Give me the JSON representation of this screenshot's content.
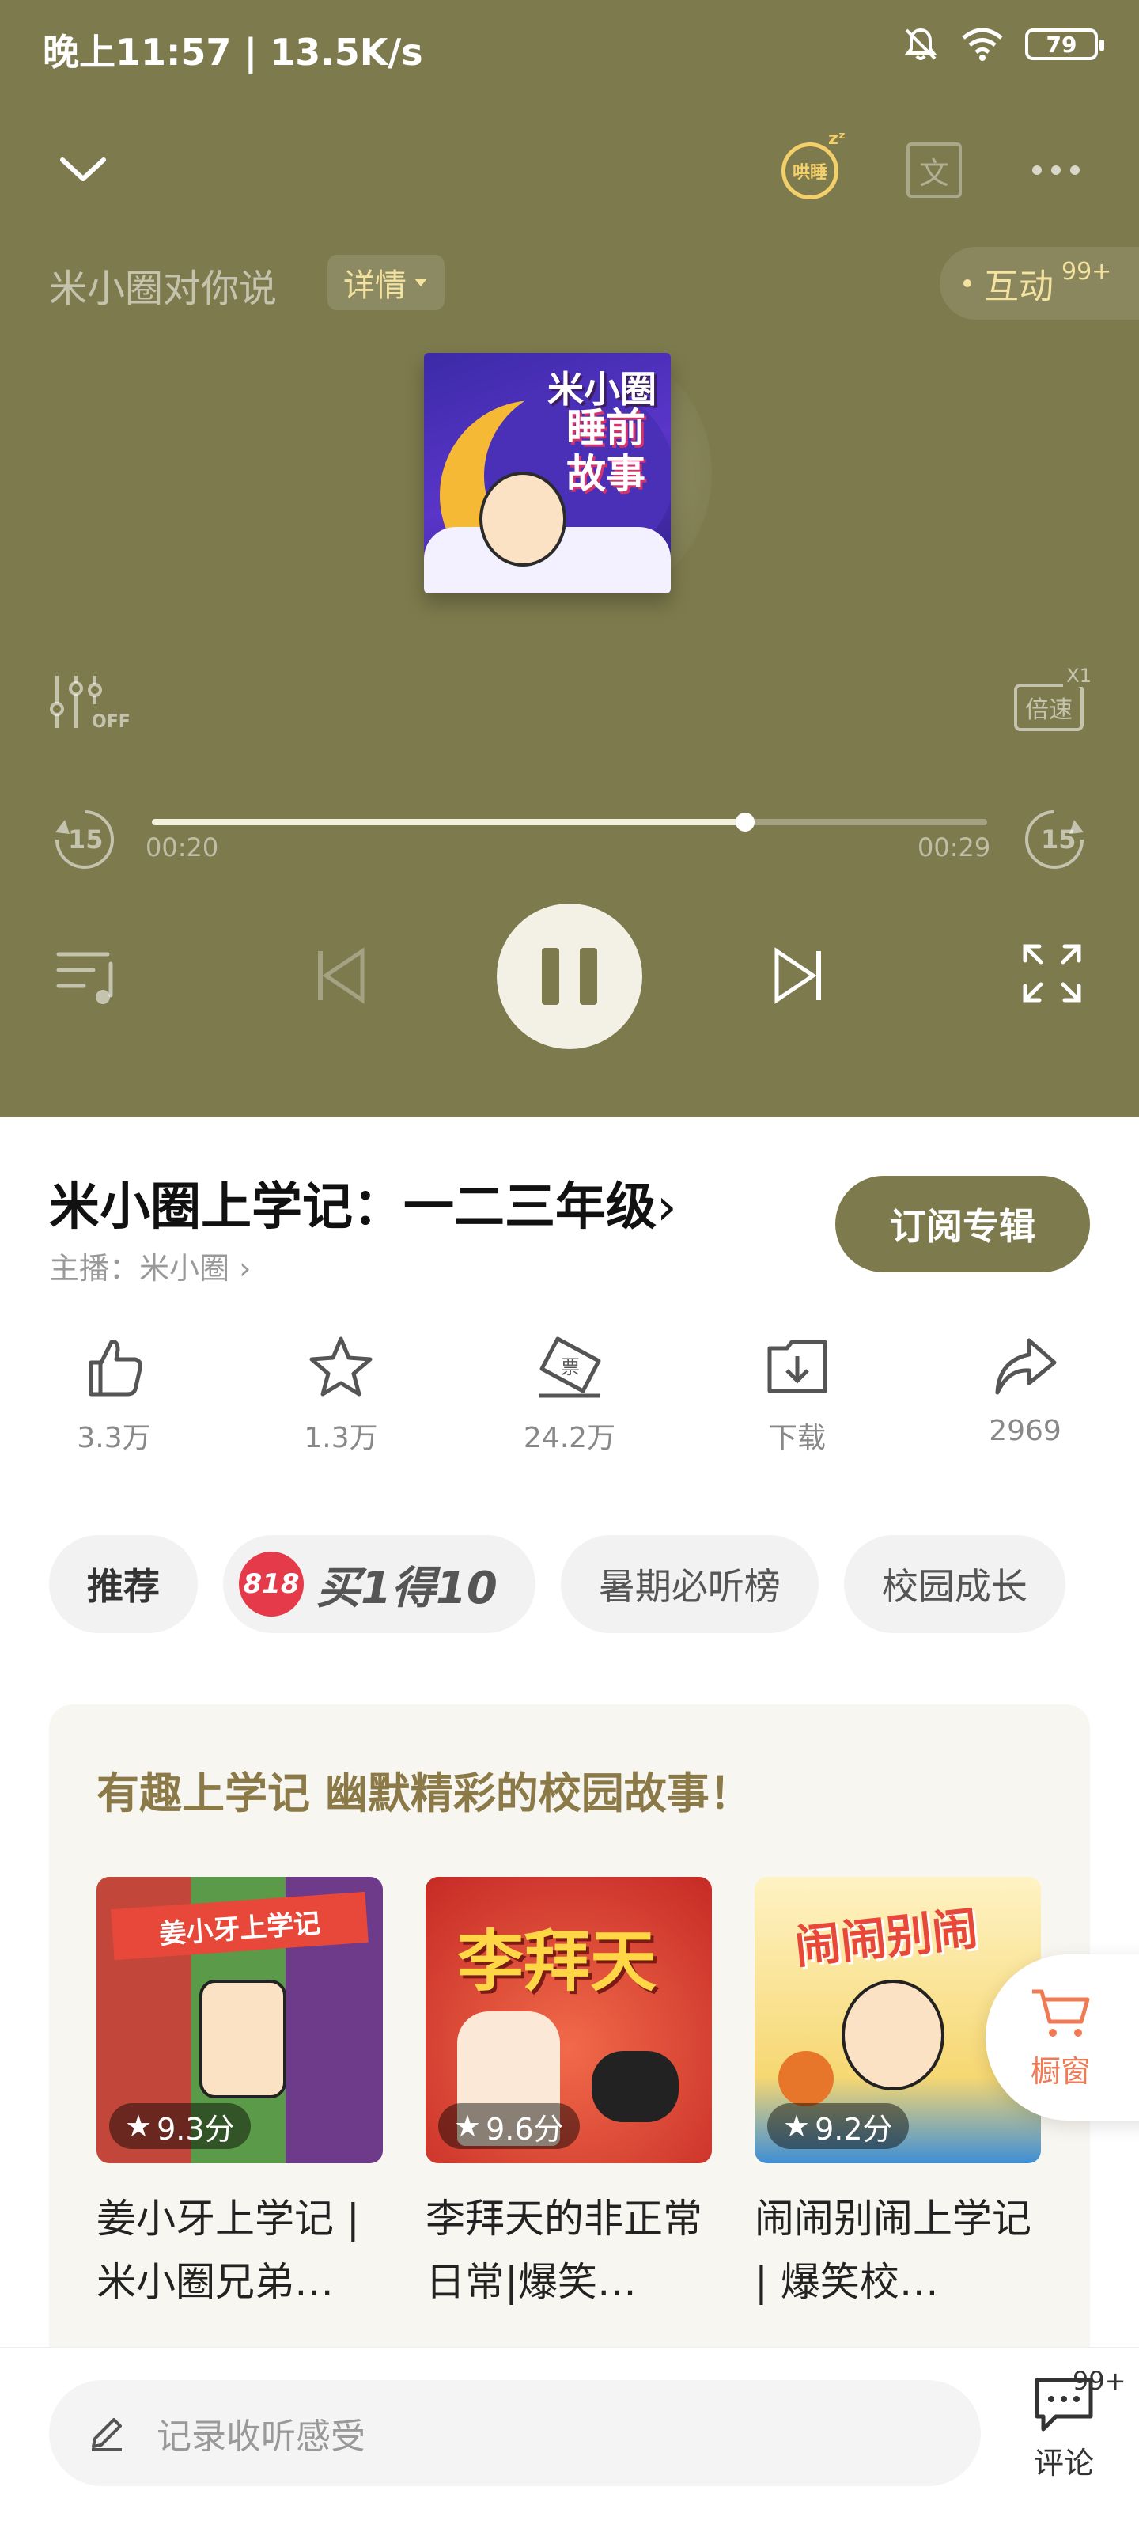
{
  "status_bar": {
    "time_speed": "晚上11:57 | 13.5K/s",
    "battery": "79"
  },
  "top_bar": {
    "sleep_label": "哄睡",
    "text_label": "文"
  },
  "player": {
    "album_by": "米小圈对你说",
    "detail_label": "详情",
    "interact_label": "互动",
    "interact_badge": "99+",
    "eq_label": "OFF",
    "speed_label": "倍速",
    "speed_value": "X1",
    "skip_back_label": "15",
    "skip_fwd_label": "15",
    "time_current": "00:20",
    "time_total": "00:29",
    "progress": 0.71,
    "cover_title_1": "米小圈",
    "cover_title_2": "睡前故事"
  },
  "track": {
    "title": "米小圈上学记：一二三年级",
    "host": "主播：米小圈",
    "subscribe_label": "订阅专辑"
  },
  "actions": [
    {
      "icon": "thumbs-up-icon",
      "count": "3.3万"
    },
    {
      "icon": "star-icon",
      "count": "1.3万"
    },
    {
      "icon": "ticket-icon",
      "count": "24.2万"
    },
    {
      "icon": "download-icon",
      "count": "下载"
    },
    {
      "icon": "share-icon",
      "count": "2969"
    }
  ],
  "tags": {
    "recommend": "推荐",
    "promo_badge": "818",
    "promo_text": "买1得10",
    "chart": "暑期必听榜",
    "campus": "校园成长"
  },
  "recommendations": {
    "heading": "有趣上学记 幽默精彩的校园故事！",
    "items": [
      {
        "score": "9.3分",
        "title": "姜小牙上学记 | 米小圈兄弟…",
        "cover_text": "姜小牙上学记",
        "color": "#e8483a"
      },
      {
        "score": "9.6分",
        "title": "李拜天的非正常日常|爆笑…",
        "cover_text": "李拜天",
        "color": "#d9302c"
      },
      {
        "score": "9.2分",
        "title": "闹闹别闹上学记 | 爆笑校…",
        "cover_text": "闹闹别闹",
        "color": "#f0c24a"
      }
    ]
  },
  "shop": {
    "label": "橱窗"
  },
  "bottom": {
    "comment_placeholder": "记录收听感受",
    "comment_label": "评论",
    "comment_badge": "99+"
  },
  "colors": {
    "player_bg": "#7d7a4d",
    "accent_gold": "#f4e2a0",
    "promo_red": "#e53a4a"
  }
}
